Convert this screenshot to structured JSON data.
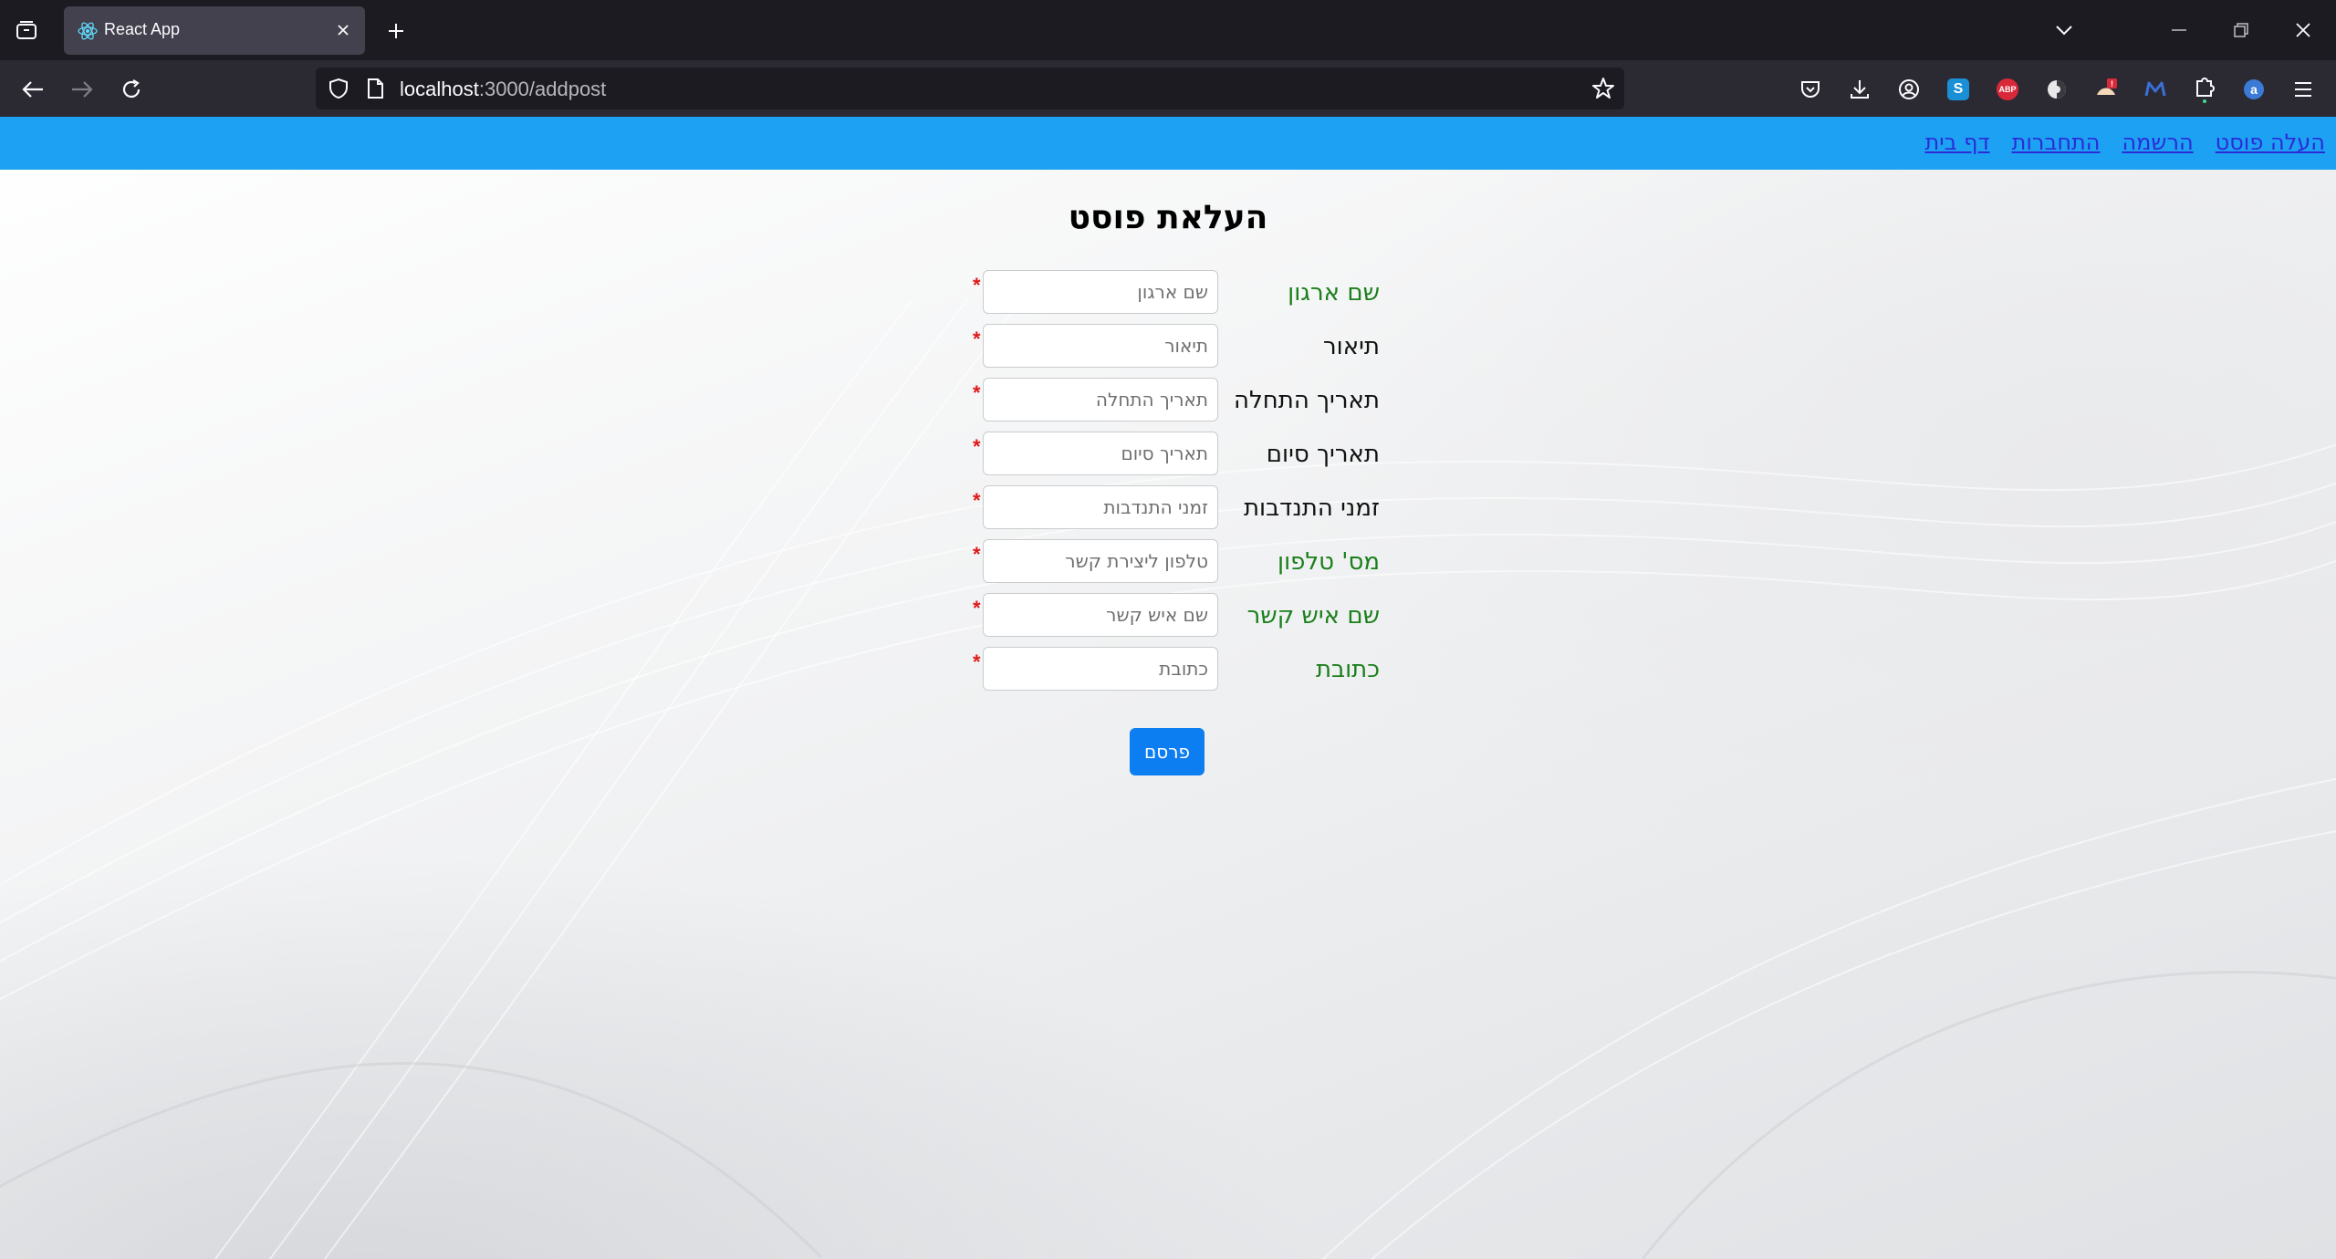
{
  "browser": {
    "tab_title": "React App",
    "url_host": "localhost",
    "url_path": ":3000/addpost"
  },
  "extensions": [
    {
      "name": "pocket-icon"
    },
    {
      "name": "download-icon"
    },
    {
      "name": "account-icon"
    },
    {
      "name": "s-extension-icon",
      "label": "S",
      "color": "#1a8fd6"
    },
    {
      "name": "adblock-plus-icon",
      "label": "ABP",
      "color": "#d9283a"
    },
    {
      "name": "privacy-badger-icon"
    },
    {
      "name": "alert-extension-icon",
      "label": "!",
      "color": "#d9283a"
    },
    {
      "name": "m-extension-icon",
      "label": "M",
      "color": "#3a6fd8"
    },
    {
      "name": "puzzle-extensions-icon"
    },
    {
      "name": "a-extension-icon",
      "label": "a",
      "color": "#3b7bd6"
    },
    {
      "name": "menu-icon"
    }
  ],
  "site_nav": {
    "home": "דף בית",
    "login": "התחברות",
    "register": "הרשמה",
    "add_post": "העלה פוסט"
  },
  "page": {
    "title": "העלאת פוסט",
    "submit_label": "פרסם",
    "required_mark": "*"
  },
  "form": {
    "fields": [
      {
        "label": "שם ארגון",
        "placeholder": "שם ארגון",
        "value": "",
        "label_color": "#1b7f1b"
      },
      {
        "label": "תיאור",
        "placeholder": "תיאור",
        "value": "",
        "label_color": "#111111"
      },
      {
        "label": "תאריך התחלה",
        "placeholder": "תאריך התחלה",
        "value": "",
        "label_color": "#111111"
      },
      {
        "label": "תאריך סיום",
        "placeholder": "תאריך סיום",
        "value": "",
        "label_color": "#111111"
      },
      {
        "label": "זמני התנדבות",
        "placeholder": "זמני התנדבות",
        "value": "",
        "label_color": "#111111"
      },
      {
        "label": "מס' טלפון",
        "placeholder": "טלפון ליצירת קשר",
        "value": "",
        "label_color": "#1b7f1b"
      },
      {
        "label": "שם איש קשר",
        "placeholder": "שם איש קשר",
        "value": "",
        "label_color": "#1b7f1b"
      },
      {
        "label": "כתובת",
        "placeholder": "כתובת",
        "value": "",
        "label_color": "#1b7f1b"
      }
    ]
  },
  "colors": {
    "header_blue": "#1da1f2",
    "link": "#2b2bd9",
    "button": "#0d7ef2",
    "required": "#e01818"
  }
}
